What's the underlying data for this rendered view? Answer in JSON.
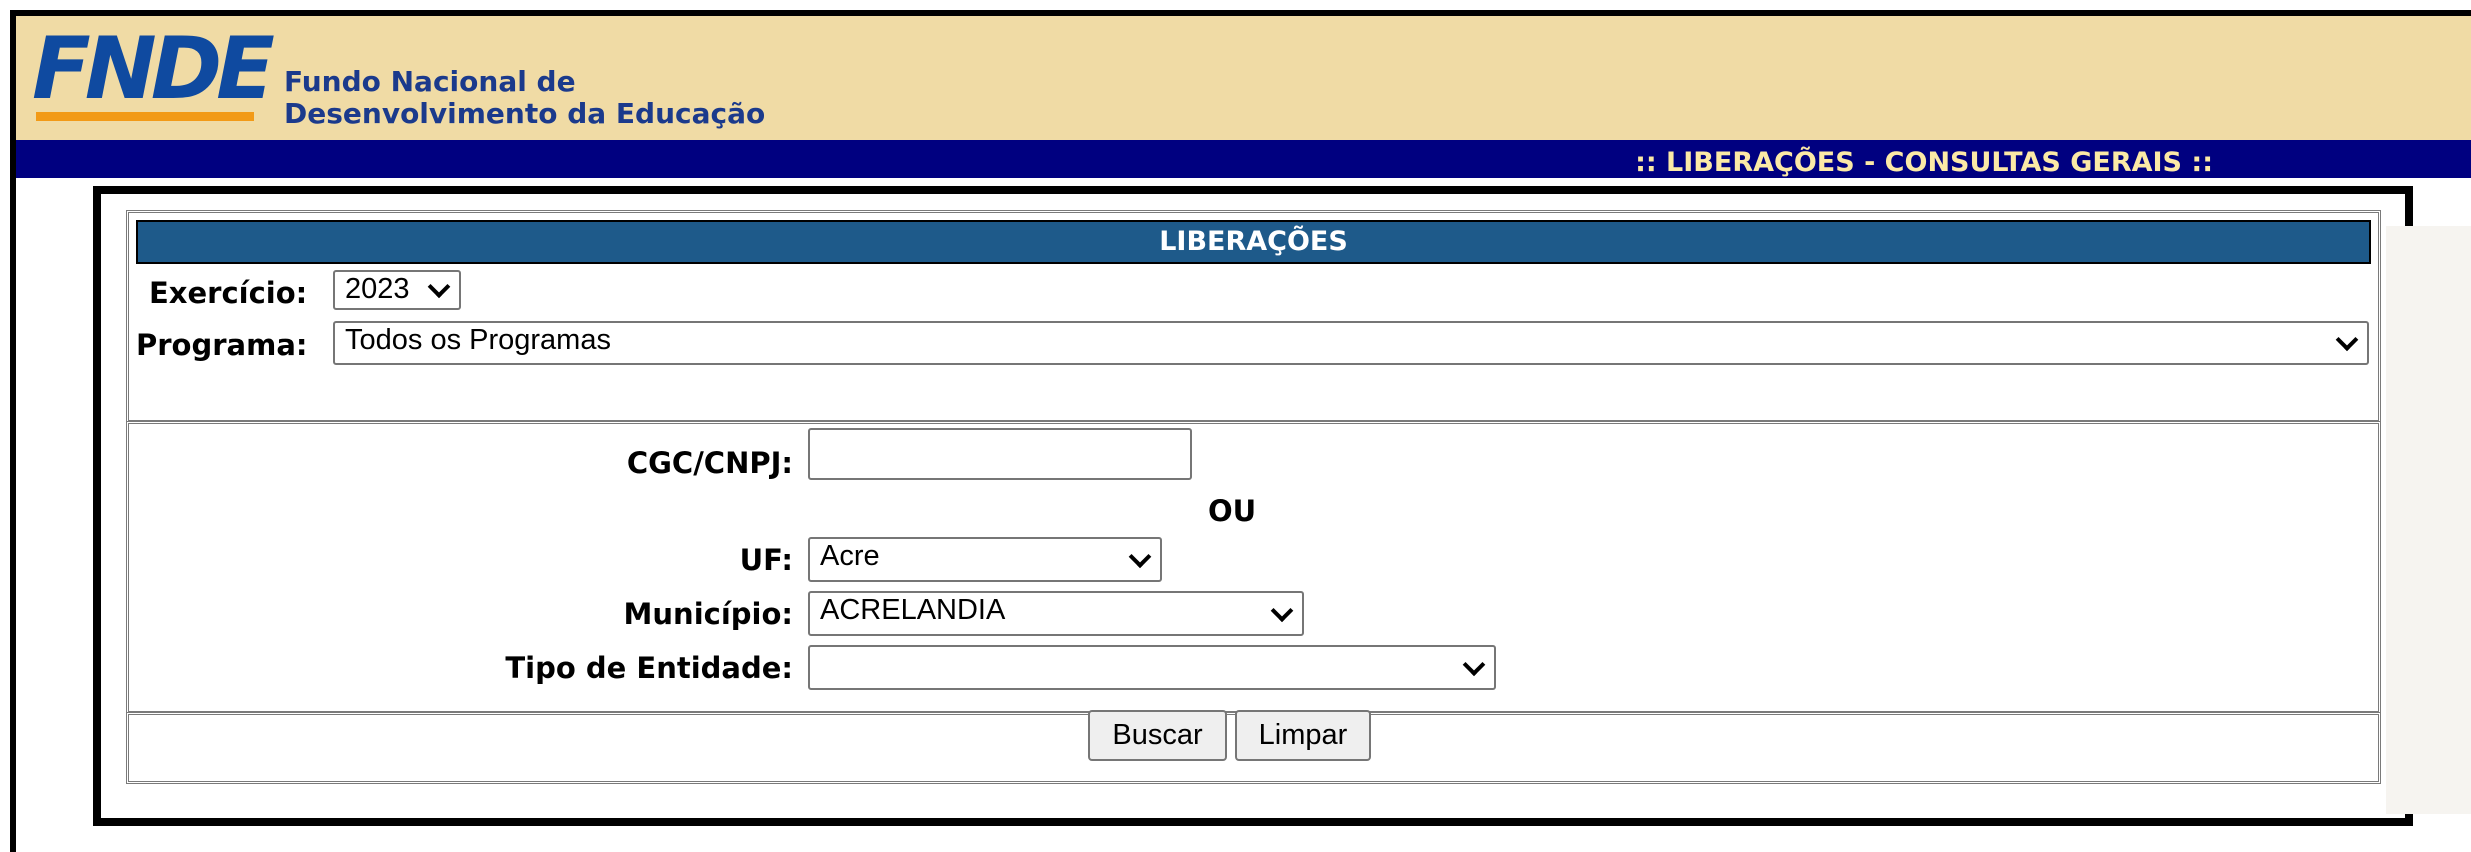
{
  "header": {
    "logo_text": "FNDE",
    "org_name_line1": "Fundo Nacional de",
    "org_name_line2": "Desenvolvimento da Educação"
  },
  "navbar": {
    "title": ":: LIBERAÇÕES - CONSULTAS GERAIS ::"
  },
  "section": {
    "title": "LIBERAÇÕES"
  },
  "filters": {
    "exercicio_label": "Exercício:",
    "exercicio_value": "2023",
    "programa_label": "Programa:",
    "programa_value": "Todos os Programas"
  },
  "search": {
    "cnpj_label": "CGC/CNPJ:",
    "cnpj_value": "",
    "ou_label": "OU",
    "uf_label": "UF:",
    "uf_value": "Acre",
    "municipio_label": "Município:",
    "municipio_value": "ACRELANDIA",
    "tipo_label": "Tipo de Entidade:",
    "tipo_value": ""
  },
  "actions": {
    "buscar_label": "Buscar",
    "limpar_label": "Limpar"
  },
  "colors": {
    "header_bg": "#f0dba5",
    "navbar_bg": "#000080",
    "navbar_text": "#fbe9a6",
    "section_title_bg": "#1e5a8a",
    "logo_blue": "#0f4aa0",
    "logo_orange": "#f29a17"
  }
}
